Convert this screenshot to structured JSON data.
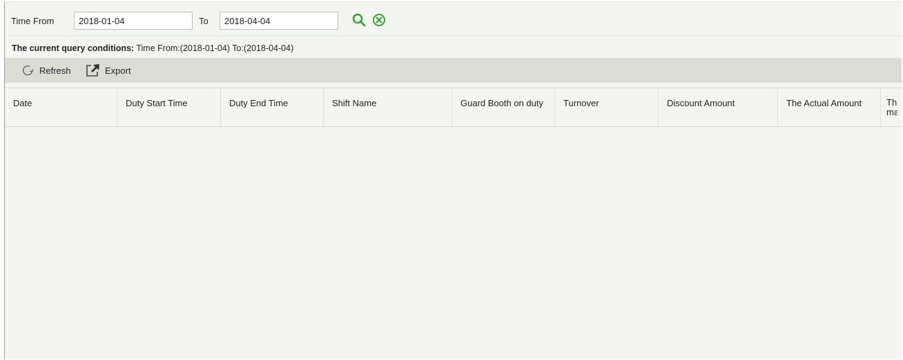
{
  "query": {
    "time_from_label": "Time From",
    "time_from_value": "2018-01-04",
    "to_label": "To",
    "to_value": "2018-04-04"
  },
  "conditions": {
    "prefix": "The current query conditions:",
    "text": "Time From:(2018-01-04)  To:(2018-04-04)"
  },
  "toolbar": {
    "refresh_label": "Refresh",
    "export_label": "Export"
  },
  "table": {
    "columns": [
      "Date",
      "Duty Start Time",
      "Duty End Time",
      "Shift Name",
      "Guard Booth on duty",
      "Turnover",
      "Discount Amount",
      "The Actual Amount",
      "Th ma"
    ],
    "rows": []
  },
  "colors": {
    "search_icon": "#3f9e35",
    "clear_icon": "#3f9e35",
    "panel_bg": "#f3f5f0",
    "toolbar_bg": "#d9ddd4"
  }
}
